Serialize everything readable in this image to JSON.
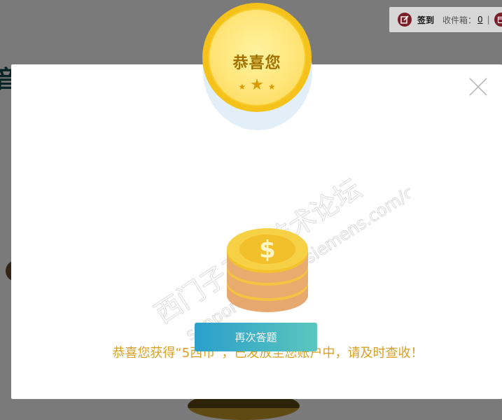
{
  "background": {
    "heading_fragment": "音"
  },
  "topbar": {
    "signin_label": "签到",
    "inbox_label": "收件箱：",
    "inbox_count": "0",
    "separator": "|"
  },
  "modal": {
    "medal_title": "恭喜您",
    "message": "恭喜您获得“5西币”，已发放至您账户中，请及时查收！",
    "retry_button": "再次答题",
    "watermark_line1": "西门子工业技术论坛",
    "watermark_line2": "support.industry.siemens.com/cs"
  },
  "colors": {
    "accent_gold": "#d8a024",
    "button_start": "#2a9fca",
    "button_end": "#5cc6be"
  }
}
